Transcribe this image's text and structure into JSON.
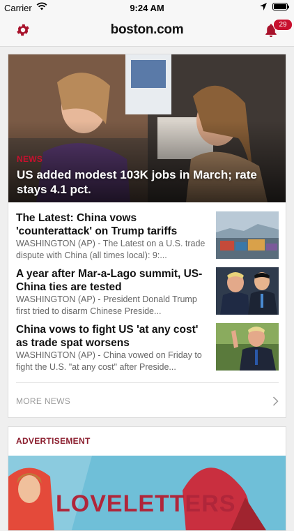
{
  "status_bar": {
    "carrier": "Carrier",
    "time": "9:24 AM"
  },
  "nav": {
    "logo": "boston.com",
    "notification_count": "29",
    "icons": {
      "left": "gear-icon",
      "right": "bell-icon"
    },
    "accent_color": "#b0102a"
  },
  "top_story": {
    "category": "NEWS",
    "title": "US added modest 103K jobs in March; rate stays 4.1 pct."
  },
  "stories": [
    {
      "title": "The Latest: China vows 'counterattack' on Trump tariffs",
      "description": "WASHINGTON (AP) - The Latest on a U.S. trade dispute with China (all times local): 9:..."
    },
    {
      "title": "A year after Mar-a-Lago summit, US-China ties are tested",
      "description": "WASHINGTON (AP) - President Donald Trump first tried to disarm Chinese Preside..."
    },
    {
      "title": "China vows to fight US 'at any cost' as trade spat worsens",
      "description": "WASHINGTON (AP) - China vowed on Friday to fight the U.S. \"at any cost\" after Preside..."
    }
  ],
  "more_news_label": "MORE NEWS",
  "advertisement": {
    "label": "ADVERTISEMENT",
    "banner_text": "LOVELETTERS"
  }
}
